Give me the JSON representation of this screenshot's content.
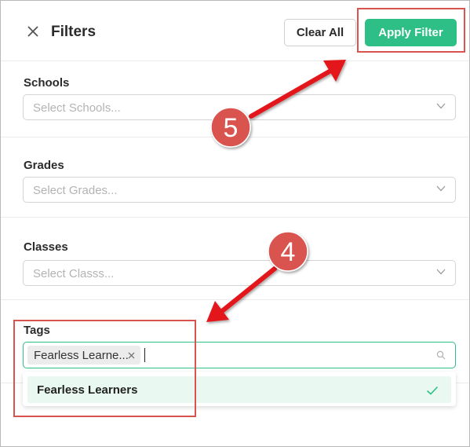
{
  "header": {
    "title": "Filters",
    "clear_label": "Clear All",
    "apply_label": "Apply Filter"
  },
  "filters": {
    "schools": {
      "label": "Schools",
      "placeholder": "Select Schools..."
    },
    "grades": {
      "label": "Grades",
      "placeholder": "Select Grades..."
    },
    "classes": {
      "label": "Classes",
      "placeholder": "Select Classs..."
    },
    "tags": {
      "label": "Tags",
      "chip": "Fearless Learne...",
      "options": [
        {
          "label": "Fearless Learners",
          "selected": true
        }
      ]
    }
  },
  "annotations": {
    "step_apply": "5",
    "step_tags": "4"
  },
  "colors": {
    "accent": "#2dbf85",
    "annotation": "#d9534f",
    "arrow": "#e3191c"
  }
}
